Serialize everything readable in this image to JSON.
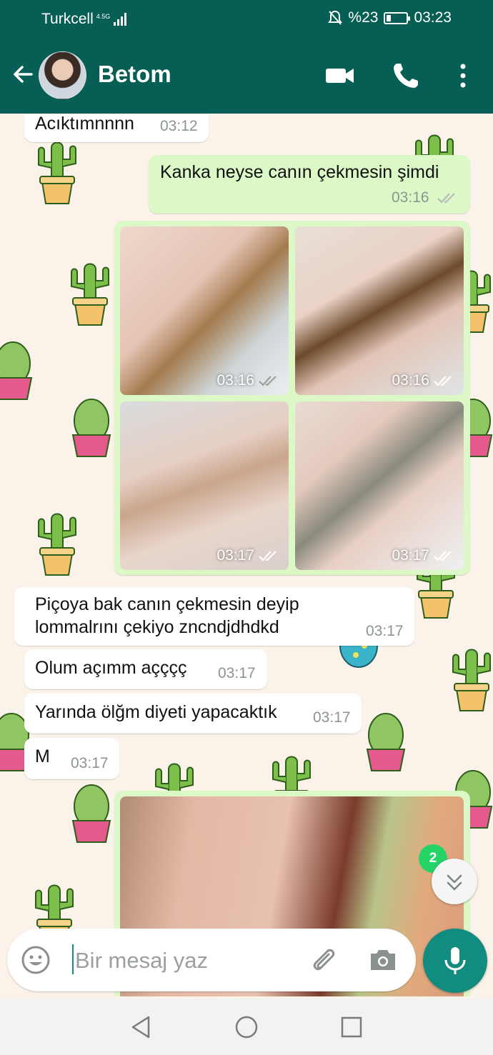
{
  "status_bar": {
    "carrier": "Turkcell",
    "network": "4.5G",
    "battery_percent": "%23",
    "battery_level": 0.23,
    "time": "03:23"
  },
  "header": {
    "contact_name": "Betom",
    "icons": [
      "back-arrow-icon",
      "video-call-icon",
      "phone-icon",
      "more-vert-icon"
    ]
  },
  "messages": [
    {
      "direction": "in",
      "text": "Acıktımnnnn",
      "time": "03:12"
    },
    {
      "direction": "out",
      "text": "Kanka neyse canın çekmesin şimdi",
      "time": "03:16",
      "status": "read"
    },
    {
      "direction": "out",
      "type": "photo",
      "time": "03:16",
      "status": "sent"
    },
    {
      "direction": "out",
      "type": "photo",
      "time": "03:16",
      "status": "read"
    },
    {
      "direction": "out",
      "type": "photo",
      "time": "03:17",
      "status": "read"
    },
    {
      "direction": "out",
      "type": "photo",
      "time": "03:17",
      "status": "read"
    },
    {
      "direction": "in",
      "lines": [
        "Piçoya bak canın çekmesin deyip",
        "lommalrını çekiyo zncndjdhdkd"
      ],
      "time": "03:17"
    },
    {
      "direction": "in",
      "text": "Olum açımm açççç",
      "time": "03:17"
    },
    {
      "direction": "in",
      "text": "Yarında ölğm diyeti yapacaktık",
      "time": "03:17"
    },
    {
      "direction": "in",
      "text": "M",
      "time": "03:17"
    },
    {
      "direction": "out",
      "type": "photo"
    }
  ],
  "unread_badge": "2",
  "input": {
    "placeholder": "Bir mesaj yaz"
  },
  "colors": {
    "header": "#075e54",
    "accent": "#128c7e",
    "outgoing_bubble": "#dcf8c6",
    "incoming_bubble": "#ffffff",
    "badge": "#25d366",
    "read_ticks": "#ffffff"
  }
}
